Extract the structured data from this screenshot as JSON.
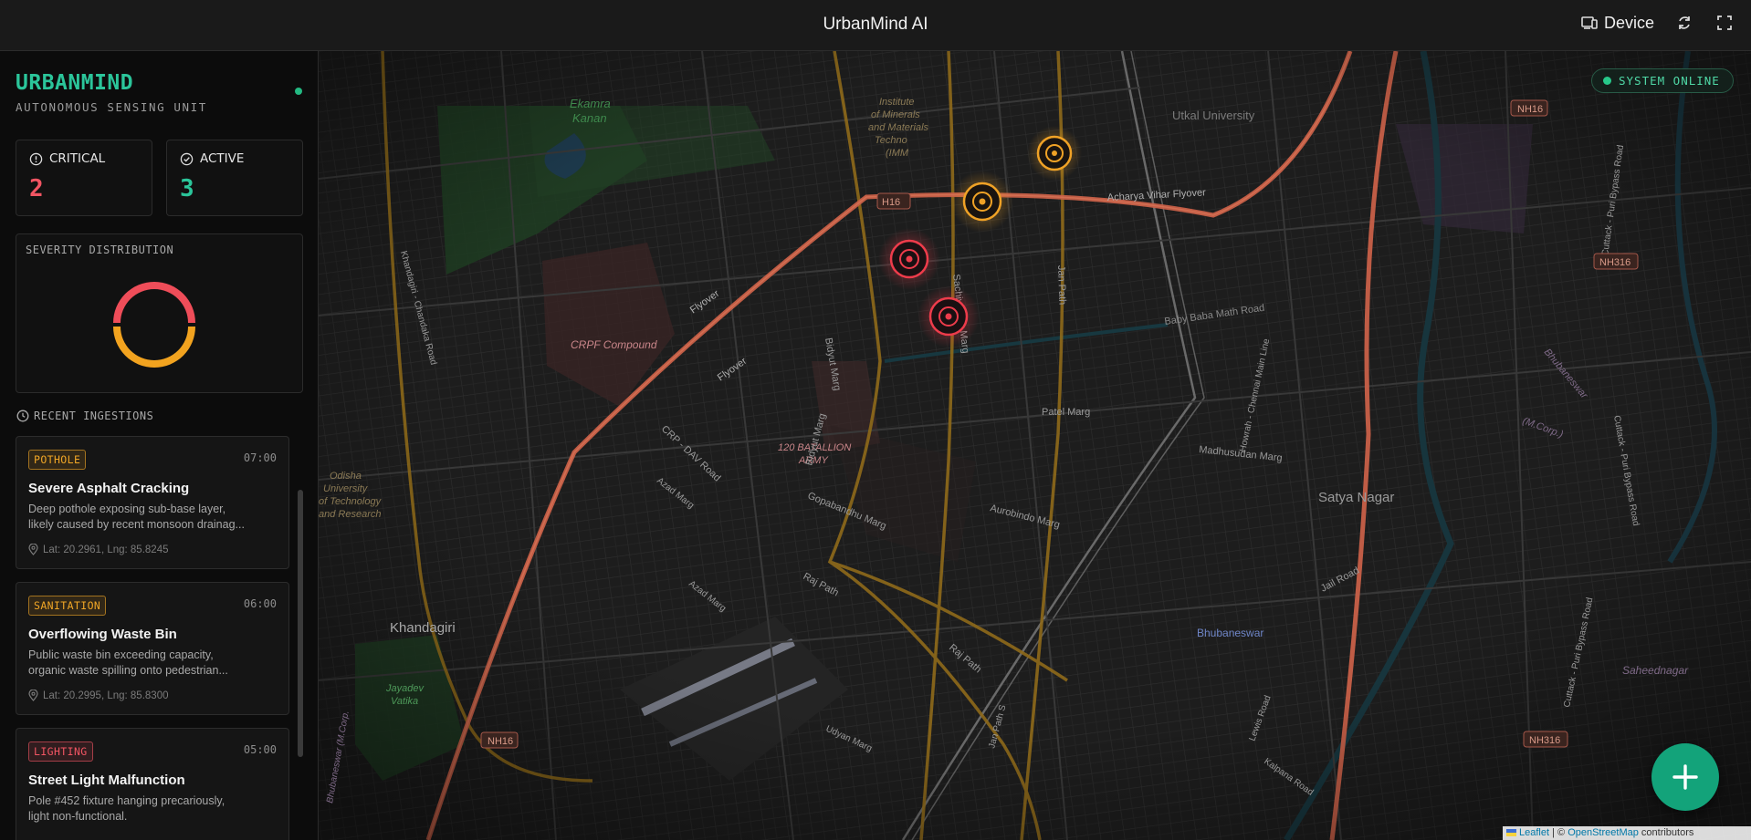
{
  "header": {
    "title": "UrbanMind AI",
    "device_label": "Device"
  },
  "sidebar": {
    "brand": "URBANMIND",
    "subtitle": "AUTONOMOUS SENSING UNIT",
    "stats": {
      "critical": {
        "label": "CRITICAL",
        "value": "2",
        "color": "#f25563"
      },
      "active": {
        "label": "ACTIVE",
        "value": "3",
        "color": "#2bc59a"
      }
    },
    "severity": {
      "title": "SEVERITY DISTRIBUTION",
      "segments": [
        {
          "level": "critical",
          "count": 2,
          "color": "#ef4d59"
        },
        {
          "level": "moderate",
          "count": 3,
          "color": "#f2a31f"
        }
      ]
    },
    "recent_title": "RECENT INGESTIONS",
    "items": [
      {
        "category": "POTHOLE",
        "tone": "amber",
        "time": "07:00",
        "title": "Severe Asphalt Cracking",
        "desc1": "Deep pothole exposing sub-base layer,",
        "desc2": "likely caused by recent monsoon drainag...",
        "loc": "Lat: 20.2961, Lng: 85.8245"
      },
      {
        "category": "SANITATION",
        "tone": "amber",
        "time": "06:00",
        "title": "Overflowing Waste Bin",
        "desc1": "Public waste bin exceeding capacity,",
        "desc2": "organic waste spilling onto pedestrian...",
        "loc": "Lat: 20.2995, Lng: 85.8300"
      },
      {
        "category": "LIGHTING",
        "tone": "red",
        "time": "05:00",
        "title": "Street Light Malfunction",
        "desc1": "Pole #452 fixture hanging precariously,",
        "desc2": "light non-functional.",
        "loc": ""
      }
    ]
  },
  "map": {
    "status": "SYSTEM ONLINE",
    "fab_icon": "plus-icon",
    "attribution": {
      "leaflet": "Leaflet",
      "sep": "| ©",
      "osm": "OpenStreetMap",
      "suffix": "contributors"
    },
    "labels": {
      "ekamra": "Ekamra",
      "kanan": "Kanan",
      "inst1": "Institute",
      "inst2": "of Minerals",
      "inst3": "and Materials",
      "inst4": "Techno",
      "inst5": "(IMM",
      "utkal": "Utkal University",
      "nh16_a": "NH16",
      "nh16_b": "NH16",
      "nh16_c": "NH16",
      "nh16_d": "H16",
      "nh316_a": "NH316",
      "nh316_b": "NH316",
      "acharya": "Acharya Vihar Flyover",
      "flyover1": "Flyover",
      "flyover2": "Flyover",
      "crpf": "CRPF Compound",
      "khandagiri_chandaka": "Khandagiri - Chandaka Road",
      "sachivalaya": "Sachivalaya Marg",
      "janpath": "Jan Path",
      "babybaba": "Baby Baba Math Road",
      "bidyut": "Bidyut Marg",
      "patel": "Patel Marg",
      "madhusudan": "Madhusudan Marg",
      "batallion1": "120 BATALLION",
      "batallion2": "ARMY",
      "crp_dav": "CRP - DAV Road",
      "azad1": "Azad Marg",
      "azad2": "Azad Marg",
      "gopabandhu": "Gopabandhu Marg",
      "aurobindo": "Aurobindo Marg",
      "satya": "Satya Nagar",
      "bhubaneswar": "Bhubaneswar",
      "odisha1": "Odisha",
      "odisha2": "University",
      "odisha3": "of Technology",
      "odisha4": "and Research",
      "khandagiri": "Khandagiri",
      "jayadev1": "Jayadev",
      "jayadev2": "Vatika",
      "rajpath1": "Raj Path",
      "rajpath2": "Raj Path",
      "jailroad": "Jail Road",
      "howrah": "Howrah - Chennai Main Line",
      "cuttack1": "Cuttack - Puri Bypass Road",
      "cuttack2": "Cuttack - Puri Bypass Road",
      "cuttack3": "Cuttack - Puri Bypass Road",
      "bhubaneswar_corp1": "Bhubaneswar",
      "bhubaneswar_corp2": "(M.Corp.)",
      "saheednagar": "Saheednagar",
      "udyan": "Udyan Marg",
      "lewis": "Lewis Road",
      "kalpana": "Kalpana Road",
      "janpath_s": "Jan Path S",
      "bhubaneswar_mcorp": "Bhubaneswar (M.Corp."
    }
  }
}
